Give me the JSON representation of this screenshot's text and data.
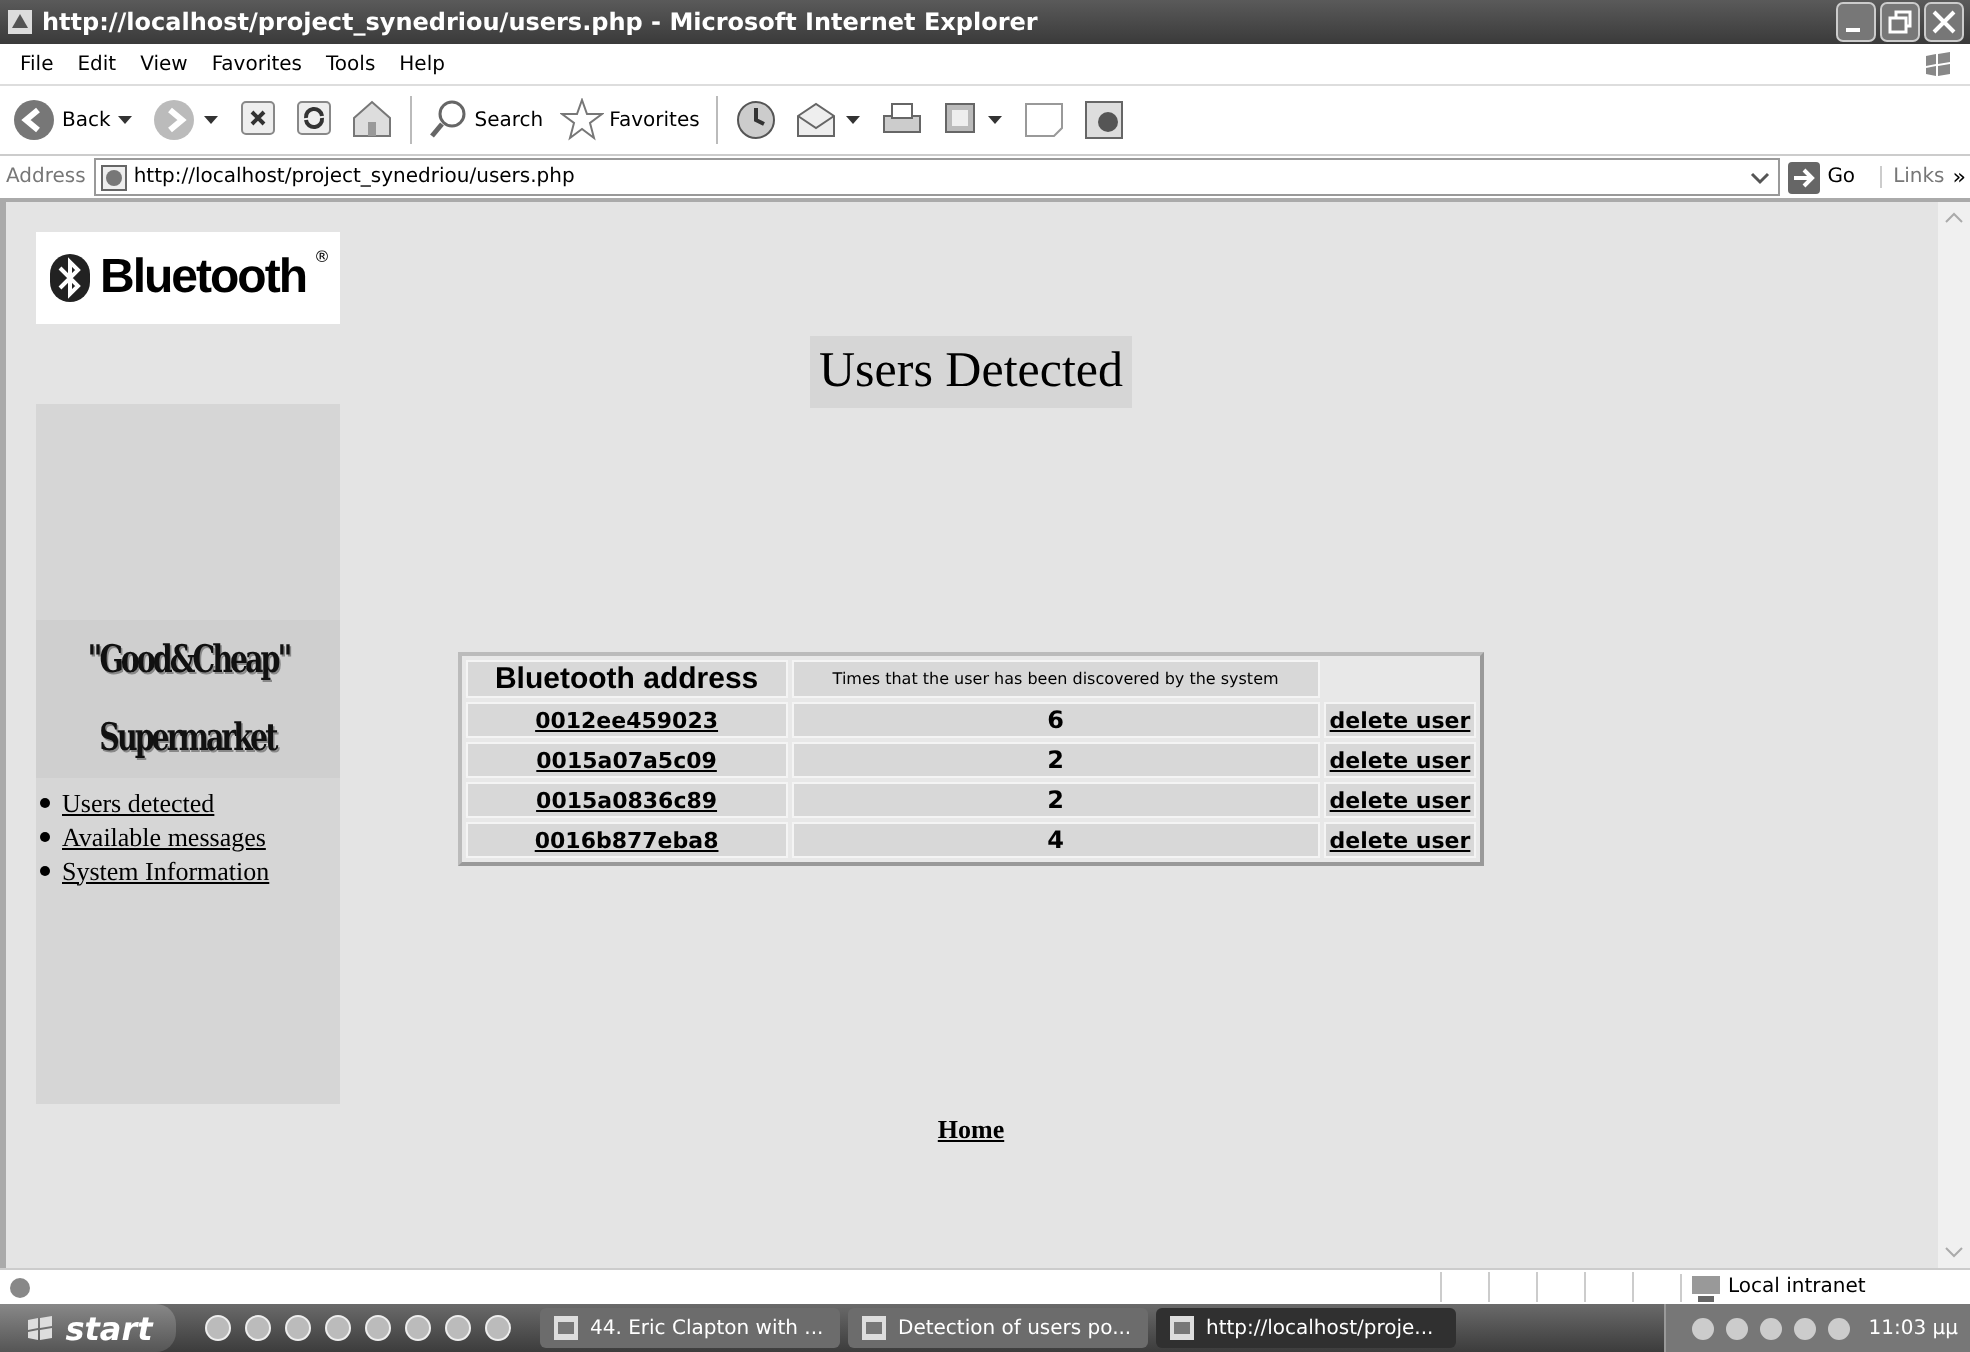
{
  "window": {
    "title": "http://localhost/project_synedriou/users.php - Microsoft Internet Explorer"
  },
  "menu": [
    "File",
    "Edit",
    "View",
    "Favorites",
    "Tools",
    "Help"
  ],
  "toolbar": [
    {
      "kind": "back",
      "label": "Back",
      "dropdown": true
    },
    {
      "kind": "forward",
      "dropdown": true
    },
    {
      "kind": "stop"
    },
    {
      "kind": "refresh"
    },
    {
      "kind": "home"
    },
    {
      "kind": "search",
      "label": "Search"
    },
    {
      "kind": "favorites",
      "label": "Favorites"
    },
    {
      "kind": "history"
    },
    {
      "kind": "mail",
      "dropdown": true
    },
    {
      "kind": "print"
    },
    {
      "kind": "edit",
      "dropdown": true
    },
    {
      "kind": "discuss"
    },
    {
      "kind": "messenger"
    }
  ],
  "address_bar": {
    "label": "Address",
    "value": "http://localhost/project_synedriou/users.php",
    "go": "Go",
    "links": "Links",
    "more": "»"
  },
  "page": {
    "brand": "Bluetooth",
    "brand_mark": "®",
    "store_logo": [
      "\"Good&Cheap\"",
      "Supermarket"
    ],
    "nav": [
      "Users detected",
      "Available messages",
      "System Information"
    ],
    "heading": "Users Detected",
    "table": {
      "columns": [
        "Bluetooth address",
        "Times that the user has been discovered by the system"
      ],
      "rows": [
        {
          "address": "0012ee459023",
          "times": "6",
          "action": "delete user"
        },
        {
          "address": "0015a07a5c09",
          "times": "2",
          "action": "delete user"
        },
        {
          "address": "0015a0836c89",
          "times": "2",
          "action": "delete user"
        },
        {
          "address": "0016b877eba8",
          "times": "4",
          "action": "delete user"
        }
      ]
    },
    "home_link": "Home"
  },
  "status_bar": {
    "zone": "Local intranet"
  },
  "taskbar": {
    "start": "start",
    "tasks": [
      {
        "label": "44. Eric Clapton with ...",
        "selected": false
      },
      {
        "label": "Detection of users po...",
        "selected": false
      },
      {
        "label": "http://localhost/proje...",
        "selected": true
      }
    ],
    "clock": "11:03 μμ"
  }
}
